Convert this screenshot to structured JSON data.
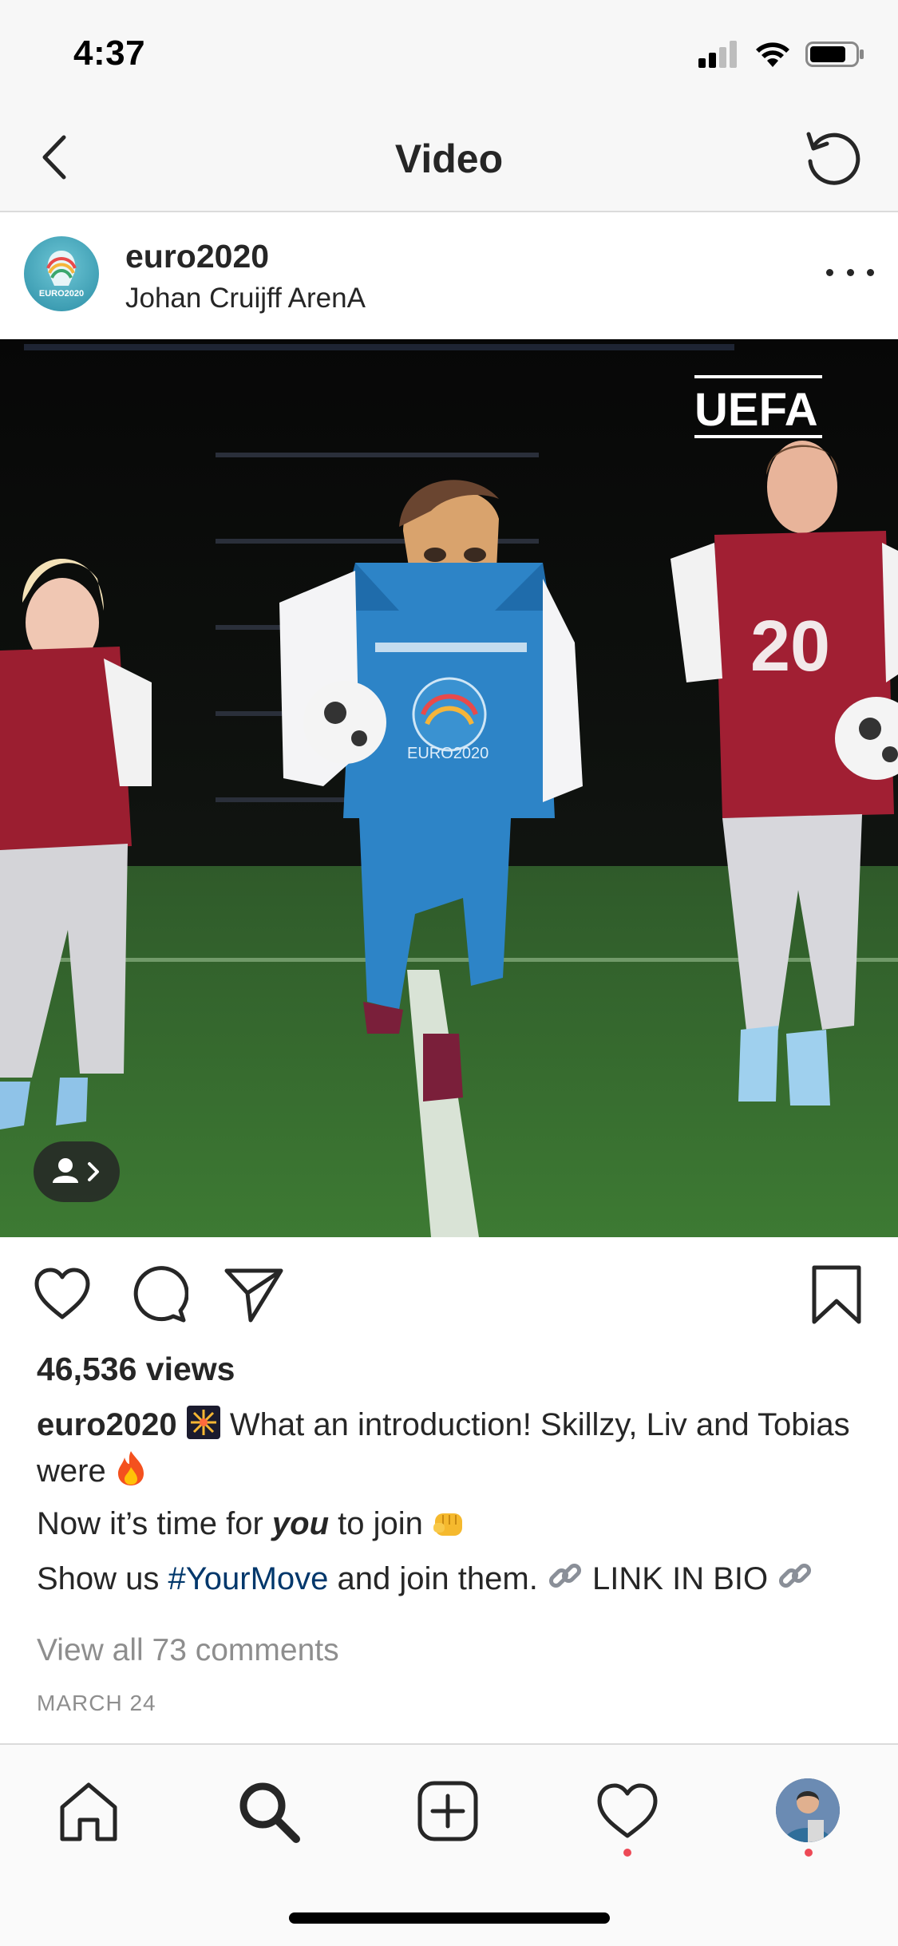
{
  "status_bar": {
    "time": "4:37",
    "icons": [
      "signal-icon",
      "wifi-icon",
      "battery-icon"
    ]
  },
  "nav": {
    "title": "Video",
    "back_icon": "chevron-left-icon",
    "refresh_icon": "refresh-icon"
  },
  "post": {
    "username": "euro2020",
    "location": "Johan Cruijff ArenA",
    "avatar_text": "EURO2020",
    "video": {
      "watermark": "UEFA",
      "jersey_number": "20",
      "mascot_shirt_text": "EURO2020",
      "tags_button_icon": "user-tag-icon"
    },
    "actions": [
      "heart-icon",
      "comment-icon",
      "share-icon",
      "bookmark-icon"
    ],
    "views": "46,536 views",
    "caption": {
      "user": "euro2020",
      "line1_text": "What an introduction!  Skillzy, Liv and Tobias were",
      "line2_pre": "Now it’s time for ",
      "line2_emph": "you",
      "line2_post": " to join",
      "line3_pre": "Show us ",
      "hashtag": "#YourMove",
      "line3_mid": " and join them. ",
      "line3_link": "LINK IN BIO",
      "emojis": [
        "sparkler",
        "fire",
        "fist",
        "link",
        "link"
      ]
    },
    "view_comments": "View all 73 comments",
    "date": "MARCH 24"
  },
  "tab_bar": {
    "tabs": [
      "home-icon",
      "search-icon",
      "new-post-icon",
      "activity-icon",
      "profile-icon"
    ],
    "notification_color": "#ed4956"
  },
  "colors": {
    "hashtag": "#00376b",
    "muted": "#8e8e8e",
    "text": "#262626"
  }
}
